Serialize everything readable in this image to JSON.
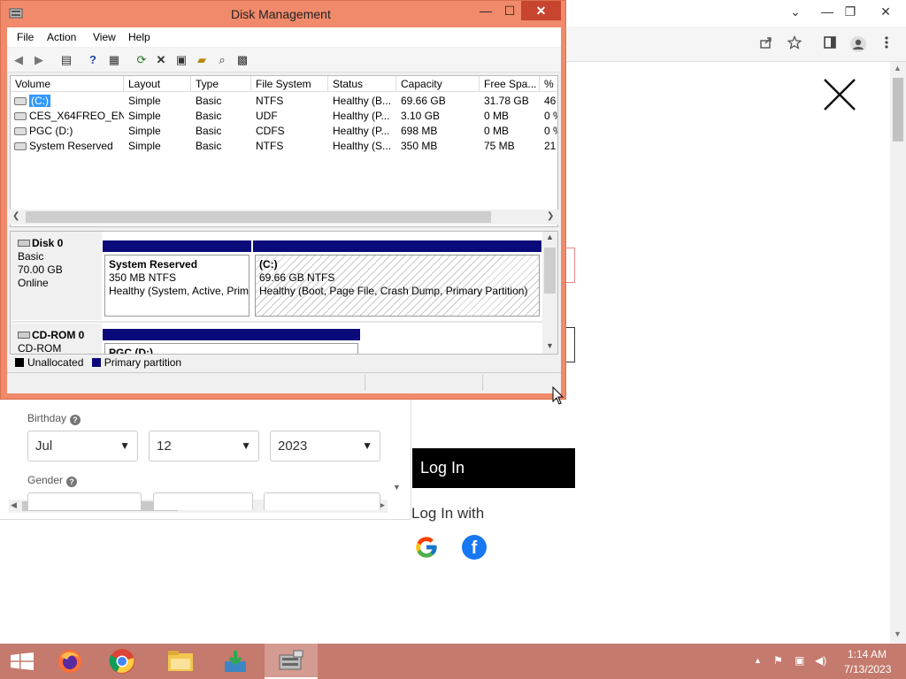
{
  "browser": {
    "controls": {
      "minimize": "—",
      "restore": "❐",
      "close": "✕",
      "dropdown": "⌄"
    },
    "toolbar_icons": [
      "share-icon",
      "star-icon",
      "sidebar-icon",
      "profile-icon",
      "menu-icon"
    ]
  },
  "signup_form": {
    "birthday_label": "Birthday",
    "gender_label": "Gender",
    "month": "Jul",
    "day": "12",
    "year": "2023"
  },
  "login": {
    "button_label": "Log In",
    "login_with": "Log In with"
  },
  "disk_management": {
    "title": "Disk Management",
    "menu": [
      "File",
      "Action",
      "View",
      "Help"
    ],
    "columns": [
      "Volume",
      "Layout",
      "Type",
      "File System",
      "Status",
      "Capacity",
      "Free Spa...",
      "% F"
    ],
    "volumes": [
      {
        "volume": "(C:)",
        "layout": "Simple",
        "type": "Basic",
        "fs": "NTFS",
        "status": "Healthy (B...",
        "capacity": "69.66 GB",
        "free": "31.78 GB",
        "pct": "46",
        "selected": true
      },
      {
        "volume": "CES_X64FREO_EN-...",
        "layout": "Simple",
        "type": "Basic",
        "fs": "UDF",
        "status": "Healthy (P...",
        "capacity": "3.10 GB",
        "free": "0 MB",
        "pct": "0 %",
        "selected": false
      },
      {
        "volume": "PGC (D:)",
        "layout": "Simple",
        "type": "Basic",
        "fs": "CDFS",
        "status": "Healthy (P...",
        "capacity": "698 MB",
        "free": "0 MB",
        "pct": "0 %",
        "selected": false
      },
      {
        "volume": "System Reserved",
        "layout": "Simple",
        "type": "Basic",
        "fs": "NTFS",
        "status": "Healthy (S...",
        "capacity": "350 MB",
        "free": "75 MB",
        "pct": "21",
        "selected": false
      }
    ],
    "disk0": {
      "name": "Disk 0",
      "kind": "Basic",
      "size": "70.00 GB",
      "state": "Online",
      "partitions": [
        {
          "name": "System Reserved",
          "size": "350 MB NTFS",
          "status": "Healthy (System, Active, Prim"
        },
        {
          "name": "(C:)",
          "size": "69.66 GB NTFS",
          "status": "Healthy (Boot, Page File, Crash Dump, Primary Partition)"
        }
      ]
    },
    "cdrom0": {
      "name": "CD-ROM 0",
      "kind": "CD-ROM",
      "partition_name": "PGC  (D:)"
    },
    "legend": {
      "unallocated": "Unallocated",
      "primary": "Primary partition",
      "unallocated_color": "#000000",
      "primary_color": "#0a0a7a"
    }
  },
  "taskbar": {
    "apps": [
      "start-icon",
      "firefox-icon",
      "chrome-icon",
      "file-explorer-icon",
      "download-app-icon",
      "disk-management-icon"
    ],
    "time": "1:14 AM",
    "date": "7/13/2023"
  },
  "colors": {
    "window_frame": "#f08a6b",
    "taskbar": "#c47a6d",
    "close_button": "#c7442f",
    "partition_bar": "#0a0a7a",
    "selection": "#3399ff"
  }
}
